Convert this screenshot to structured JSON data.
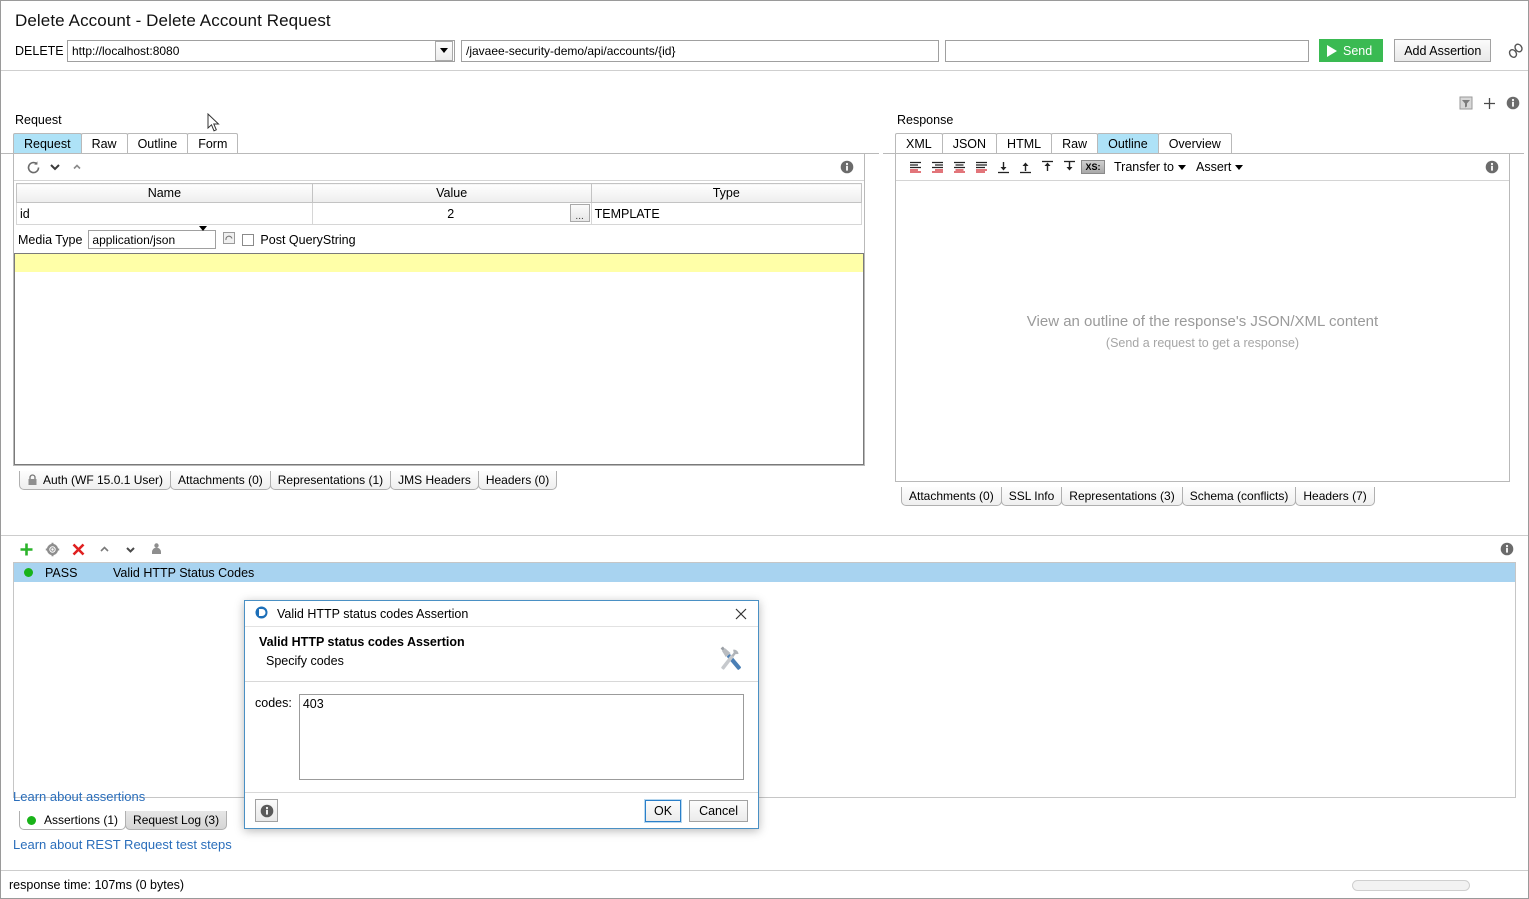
{
  "header": {
    "page_title": "Delete Account - Delete Account Request",
    "method_label": "DELETE",
    "endpoint_value": "http://localhost:8080",
    "resource_value": "/javaee-security-demo/api/accounts/{id}",
    "params_value": "",
    "params_placeholder": "",
    "send_label": "Send",
    "add_assertion_label": "Add Assertion",
    "chain_icon": "link-chain-icon",
    "top_icons": [
      "filter-icon",
      "plus-icon",
      "info-icon"
    ]
  },
  "request_panel": {
    "label": "Request",
    "tabs": [
      {
        "label": "Request",
        "active": true
      },
      {
        "label": "Raw",
        "active": false
      },
      {
        "label": "Outline",
        "active": false
      },
      {
        "label": "Form",
        "active": false
      }
    ],
    "toolbar_icons": [
      "refresh-icon",
      "chevron-down-icon",
      "chevron-up-icon"
    ],
    "info_icon": "info-icon",
    "params_table": {
      "columns": [
        "Name",
        "Value",
        "Type"
      ],
      "rows": [
        {
          "name": "id",
          "value": "2",
          "type": "TEMPLATE",
          "edit_button": "..."
        }
      ]
    },
    "media_type_label": "Media Type",
    "media_type_value": "application/json",
    "media_icon": "recursive-icon",
    "post_querystring_label": "Post QueryString",
    "post_querystring_checked": false,
    "editor_content": "",
    "bottom_tabs": [
      {
        "label": "Auth (WF 15.0.1 User)",
        "icon": "lock-icon"
      },
      {
        "label": "Attachments (0)",
        "icon": ""
      },
      {
        "label": "Representations (1)",
        "icon": ""
      },
      {
        "label": "JMS Headers",
        "icon": ""
      },
      {
        "label": "Headers (0)",
        "icon": ""
      }
    ]
  },
  "response_panel": {
    "label": "Response",
    "tabs": [
      {
        "label": "XML",
        "active": false
      },
      {
        "label": "JSON",
        "active": false
      },
      {
        "label": "HTML",
        "active": false
      },
      {
        "label": "Raw",
        "active": false
      },
      {
        "label": "Outline",
        "active": true
      },
      {
        "label": "Overview",
        "active": false
      }
    ],
    "toolbar_icons": [
      "align-left-icon",
      "align-right-icon",
      "align-center-icon",
      "align-justify-icon",
      "move-down-icon",
      "move-up-icon",
      "move-top-icon",
      "move-bottom-icon",
      "xs-format-icon"
    ],
    "transfer_to_label": "Transfer to",
    "assert_label": "Assert",
    "info_icon": "info-icon",
    "empty_message": "View an outline of the response's JSON/XML content",
    "empty_submessage": "(Send a request to get a response)",
    "bottom_tabs": [
      {
        "label": "Attachments (0)"
      },
      {
        "label": "SSL Info"
      },
      {
        "label": "Representations (3)"
      },
      {
        "label": "Schema (conflicts)"
      },
      {
        "label": "Headers (7)"
      }
    ]
  },
  "assertions": {
    "toolbar_icons": [
      "add-icon",
      "configure-icon",
      "remove-icon",
      "move-up-icon",
      "move-down-icon",
      "clone-icon"
    ],
    "info_icon": "info-icon",
    "rows": [
      {
        "status": "PASS",
        "name": "Valid HTTP Status Codes",
        "selected": true
      }
    ],
    "learn_assertions_link": "Learn about assertions",
    "learn_teststeps_link": "Learn about REST Request test steps",
    "bottom_tabs": [
      {
        "label": "Assertions (1)",
        "active": false,
        "dot": true
      },
      {
        "label": "Request Log (3)",
        "active": true,
        "dot": false
      }
    ]
  },
  "dialog": {
    "window_title": "Valid HTTP status codes Assertion",
    "app_icon": "soapui-logo-icon",
    "close_icon": "close-icon",
    "heading": "Valid HTTP status codes Assertion",
    "subheading": "Specify codes",
    "tools_icon": "wrench-screwdriver-icon",
    "field_label": "codes:",
    "codes_value": "403",
    "codes_placeholder": "",
    "info_icon": "info-icon",
    "ok_label": "OK",
    "cancel_label": "Cancel"
  },
  "statusbar": {
    "text": "response time: 107ms (0 bytes)",
    "memory_icon": "memory-bar"
  },
  "colors": {
    "accent_blue": "#aee2f7",
    "send_green": "#3aba52",
    "pass_green": "#19b319",
    "selection_blue": "#a8d3f0",
    "link_blue": "#2a6ebb",
    "highlight_yellow": "#ffffa8"
  }
}
